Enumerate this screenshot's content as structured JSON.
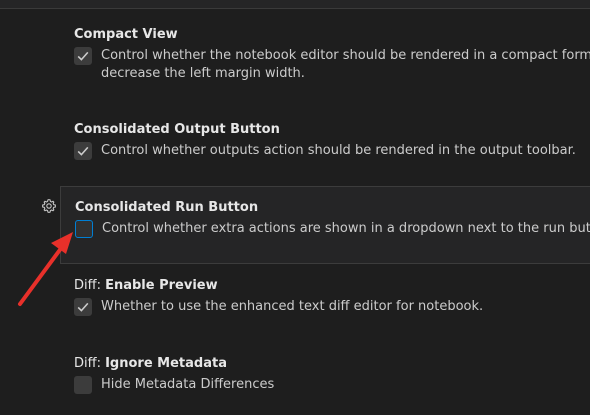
{
  "settings": [
    {
      "category": "",
      "name": "Compact View",
      "description_lines": [
        "Control whether the notebook editor should be rendered in a compact form. For exam",
        "decrease the left margin width."
      ],
      "checked": true
    },
    {
      "category": "",
      "name": "Consolidated Output Button",
      "description_lines": [
        "Control whether outputs action should be rendered in the output toolbar."
      ],
      "checked": true
    },
    {
      "category": "",
      "name": "Consolidated Run Button",
      "description_lines": [
        "Control whether extra actions are shown in a dropdown next to the run button."
      ],
      "checked": false
    },
    {
      "category": "Diff: ",
      "name": "Enable Preview",
      "description_lines": [
        "Whether to use the enhanced text diff editor for notebook."
      ],
      "checked": true
    },
    {
      "category": "Diff: ",
      "name": "Ignore Metadata",
      "description_lines": [
        "Hide Metadata Differences"
      ],
      "checked": false
    }
  ],
  "icons": {
    "gear": "gear-icon",
    "check": "check-icon"
  },
  "colors": {
    "background": "#1e1e1e",
    "focused_row": "#252526",
    "focus_border": "#007fd4",
    "annotation_arrow": "#e8302a"
  }
}
